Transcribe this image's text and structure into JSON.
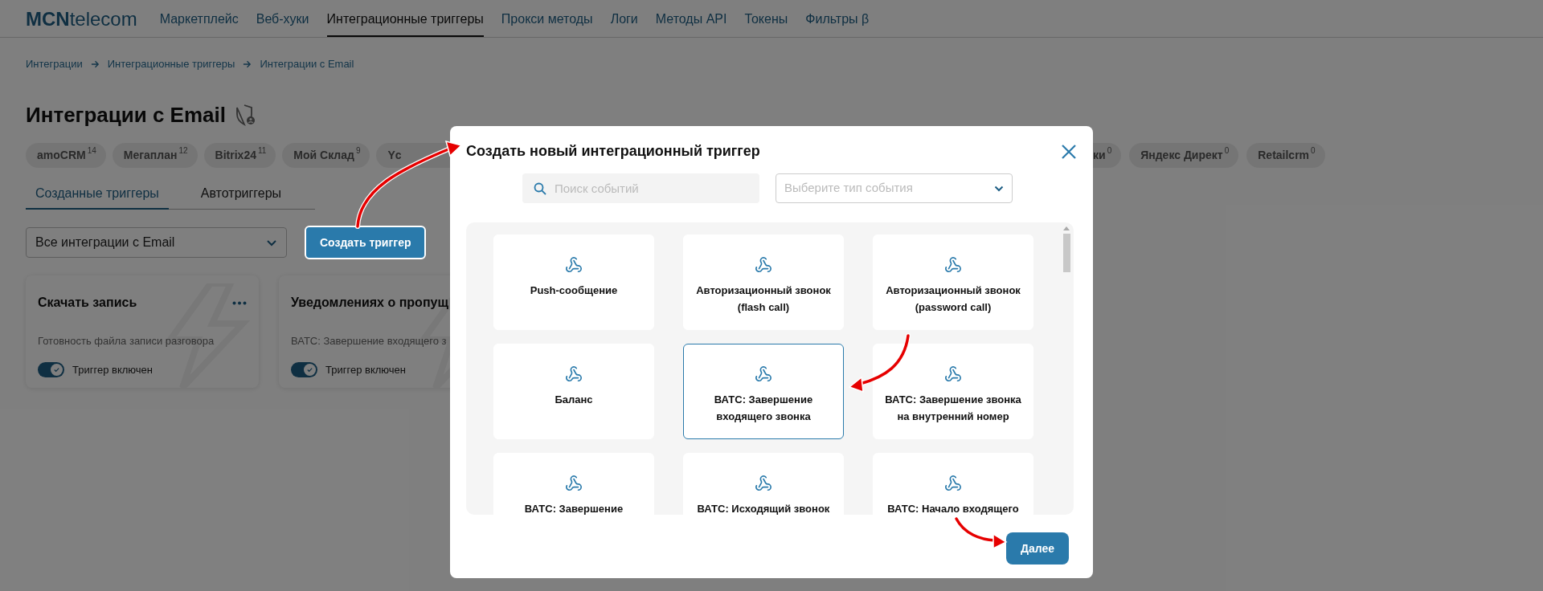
{
  "nav": {
    "logo_bold": "MCN",
    "logo_rest": "telecom",
    "items": [
      {
        "label": "Маркетплейс",
        "selected": false
      },
      {
        "label": "Веб-хуки",
        "selected": false
      },
      {
        "label": "Интеграционные триггеры",
        "selected": true
      },
      {
        "label": "Прокси методы",
        "selected": false
      },
      {
        "label": "Логи",
        "selected": false
      },
      {
        "label": "Методы API",
        "selected": false
      },
      {
        "label": "Токены",
        "selected": false
      },
      {
        "label": "Фильтры β",
        "selected": false
      }
    ]
  },
  "breadcrumbs": [
    "Интеграции",
    "Интеграционные триггеры",
    "Интеграции с Email"
  ],
  "page_title": "Интеграции с Email",
  "tags_left": [
    {
      "label": "amoCRM",
      "count": "14"
    },
    {
      "label": "Мегаплан",
      "count": "12"
    },
    {
      "label": "Bitrix24",
      "count": "11"
    },
    {
      "label": "Мой Склад",
      "count": "9"
    },
    {
      "label": "Yc"
    }
  ],
  "tags_right": [
    {
      "label": "ки",
      "count": "0"
    },
    {
      "label": "Яндекс Директ",
      "count": "0"
    },
    {
      "label": "Retailcrm",
      "count": "0"
    }
  ],
  "tabs": [
    {
      "label": "Созданные триггеры",
      "selected": true
    },
    {
      "label": "Автотриггеры",
      "selected": false
    }
  ],
  "filter": {
    "value": "Все интеграции с Email"
  },
  "create_button": "Создать триггер",
  "trigger_cards": [
    {
      "title": "Скачать запись",
      "event": "Готовность файла записи разговора",
      "toggle_label": "Триггер включен",
      "on": true,
      "has_menu": true
    },
    {
      "title": "Уведомлениях о пропущ",
      "event": "ВАТС: Завершение входящего з",
      "toggle_label": "Триггер включен",
      "on": true,
      "has_menu": false
    }
  ],
  "modal": {
    "title": "Создать новый интеграционный триггер",
    "search": {
      "placeholder": "Поиск событий"
    },
    "event_type": {
      "placeholder": "Выберите тип события"
    },
    "events": [
      {
        "label": "Push-сообщение",
        "selected": false
      },
      {
        "label": "Авторизационный звонок (flash call)",
        "selected": false
      },
      {
        "label": "Авторизационный звонок (password call)",
        "selected": false
      },
      {
        "label": "Баланс",
        "selected": false
      },
      {
        "label": "ВАТС: Завершение входящего звонка",
        "selected": true
      },
      {
        "label": "ВАТС: Завершение звонка на внутренний номер",
        "selected": false
      },
      {
        "label": "ВАТС: Завершение",
        "selected": false
      },
      {
        "label": "ВАТС: Исходящий звонок",
        "selected": false
      },
      {
        "label": "ВАТС: Начало входящего",
        "selected": false
      }
    ],
    "next_button": "Далее"
  }
}
